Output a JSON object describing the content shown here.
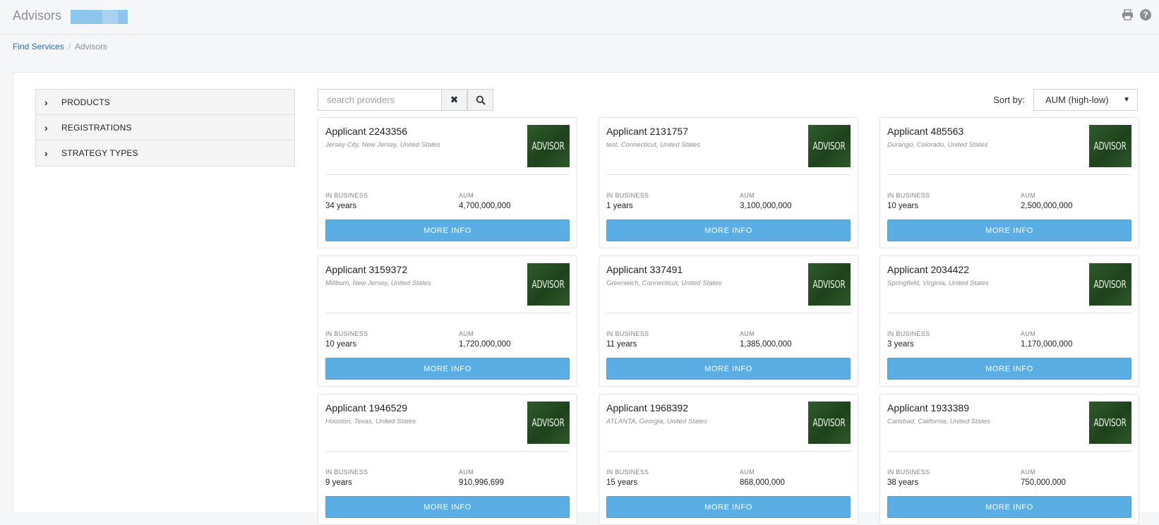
{
  "header": {
    "title": "Advisors"
  },
  "icons": {
    "print": "printer-icon",
    "help": "help-icon"
  },
  "breadcrumb": {
    "link": "Find Services",
    "separator": "/",
    "current": "Advisors"
  },
  "filters": [
    {
      "label": "PRODUCTS"
    },
    {
      "label": "REGISTRATIONS"
    },
    {
      "label": "STRATEGY TYPES"
    }
  ],
  "search": {
    "placeholder": "search providers",
    "value": ""
  },
  "sort": {
    "label": "Sort by:",
    "selected": "AUM (high-low)"
  },
  "card_labels": {
    "in_business": "IN BUSINESS",
    "aum": "AUM",
    "button": "MORE INFO",
    "logo": "ADVISOR"
  },
  "cards": [
    {
      "name": "Applicant 2243356",
      "location": "Jersey City, New Jersey, United States",
      "in_business": "34 years",
      "aum": "4,700,000,000"
    },
    {
      "name": "Applicant 2131757",
      "location": "test, Connecticut, United States",
      "in_business": "1 years",
      "aum": "3,100,000,000"
    },
    {
      "name": "Applicant 485563",
      "location": "Durango, Colorado, United States",
      "in_business": "10 years",
      "aum": "2,500,000,000"
    },
    {
      "name": "Applicant 3159372",
      "location": "Millburn, New Jersey, United States",
      "in_business": "10 years",
      "aum": "1,720,000,000"
    },
    {
      "name": "Applicant 337491",
      "location": "Greenwich, Connecticut, United States",
      "in_business": "11 years",
      "aum": "1,385,000,000"
    },
    {
      "name": "Applicant 2034422",
      "location": "Springfield, Virginia, United States",
      "in_business": "3 years",
      "aum": "1,170,000,000"
    },
    {
      "name": "Applicant 1946529",
      "location": "Houston, Texas, United States",
      "in_business": "9 years",
      "aum": "910,996,699"
    },
    {
      "name": "Applicant 1968392",
      "location": "ATLANTA, Georgia, United States",
      "in_business": "15 years",
      "aum": "868,000,000"
    },
    {
      "name": "Applicant 1933389",
      "location": "Carlsbad, California, United States",
      "in_business": "38 years",
      "aum": "750,000,000"
    }
  ]
}
